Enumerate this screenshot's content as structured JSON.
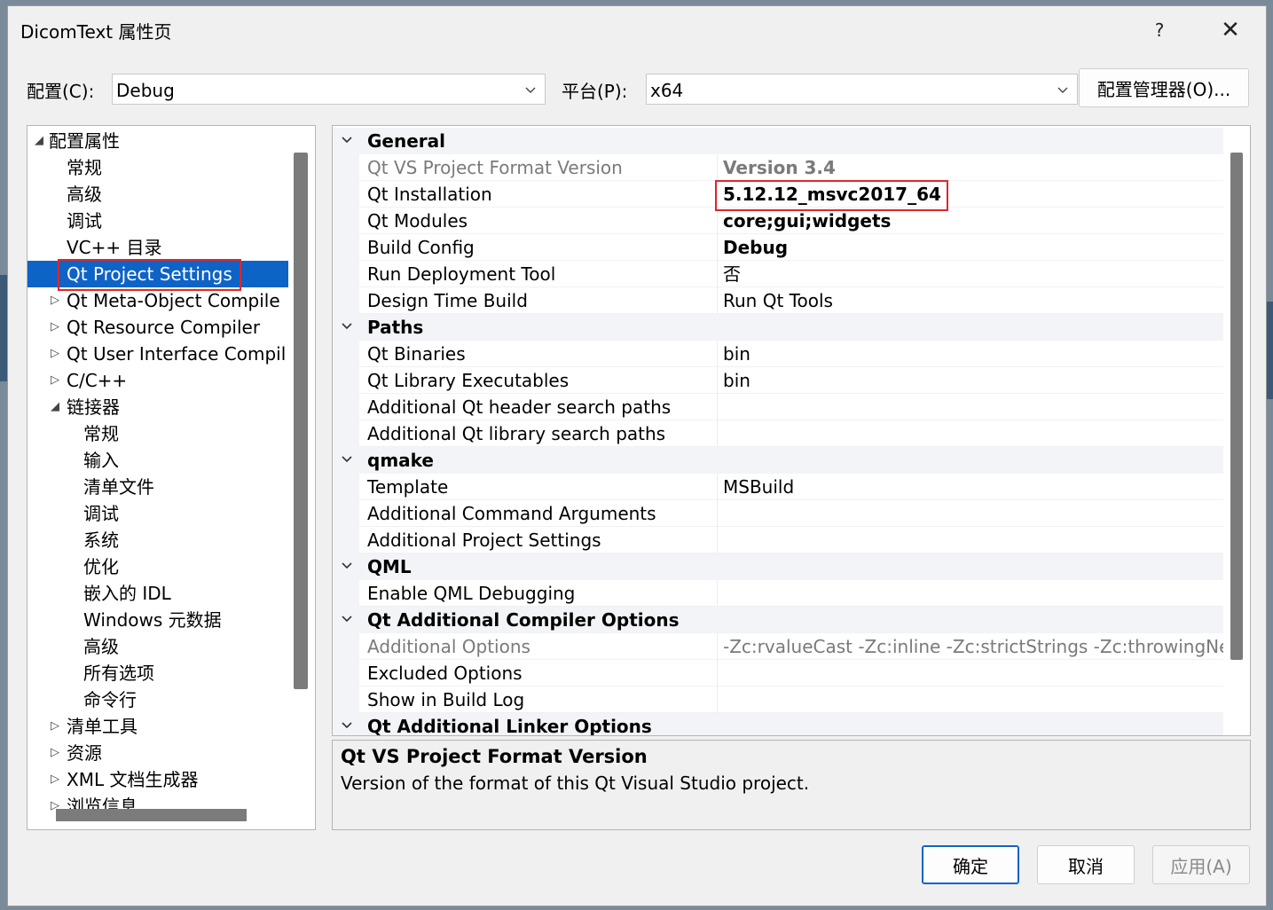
{
  "window": {
    "title": "DicomText 属性页",
    "help_label": "?",
    "close_label": "✕"
  },
  "config_bar": {
    "config_label": "配置(C):",
    "config_value": "Debug",
    "platform_label": "平台(P):",
    "platform_value": "x64",
    "manager_button": "配置管理器(O)..."
  },
  "tree": {
    "items": [
      {
        "label": "配置属性",
        "arrow": "◢"
      },
      {
        "label": "常规",
        "arrow": ""
      },
      {
        "label": "高级",
        "arrow": ""
      },
      {
        "label": "调试",
        "arrow": ""
      },
      {
        "label": "VC++ 目录",
        "arrow": ""
      },
      {
        "label": "Qt Project Settings",
        "arrow": ""
      },
      {
        "label": "Qt Meta-Object Compile",
        "arrow": "▷"
      },
      {
        "label": "Qt Resource Compiler",
        "arrow": "▷"
      },
      {
        "label": "Qt User Interface Compil",
        "arrow": "▷"
      },
      {
        "label": "C/C++",
        "arrow": "▷"
      },
      {
        "label": "链接器",
        "arrow": "◢"
      },
      {
        "label": "常规",
        "arrow": ""
      },
      {
        "label": "输入",
        "arrow": ""
      },
      {
        "label": "清单文件",
        "arrow": ""
      },
      {
        "label": "调试",
        "arrow": ""
      },
      {
        "label": "系统",
        "arrow": ""
      },
      {
        "label": "优化",
        "arrow": ""
      },
      {
        "label": "嵌入的 IDL",
        "arrow": ""
      },
      {
        "label": "Windows 元数据",
        "arrow": ""
      },
      {
        "label": "高级",
        "arrow": ""
      },
      {
        "label": "所有选项",
        "arrow": ""
      },
      {
        "label": "命令行",
        "arrow": ""
      },
      {
        "label": "清单工具",
        "arrow": "▷"
      },
      {
        "label": "资源",
        "arrow": "▷"
      },
      {
        "label": "XML 文档生成器",
        "arrow": "▷"
      },
      {
        "label": "浏览信息",
        "arrow": "▷"
      }
    ]
  },
  "grid": {
    "rows": [
      {
        "type": "cat",
        "name": "General"
      },
      {
        "type": "prop",
        "name": "Qt VS Project Format Version",
        "value": "Version 3.4"
      },
      {
        "type": "prop",
        "name": "Qt Installation",
        "value": "5.12.12_msvc2017_64"
      },
      {
        "type": "prop",
        "name": "Qt Modules",
        "value": "core;gui;widgets"
      },
      {
        "type": "prop",
        "name": "Build Config",
        "value": "Debug"
      },
      {
        "type": "prop",
        "name": "Run Deployment Tool",
        "value": "否"
      },
      {
        "type": "prop",
        "name": "Design Time Build",
        "value": "Run Qt Tools"
      },
      {
        "type": "cat",
        "name": "Paths"
      },
      {
        "type": "prop",
        "name": "Qt Binaries",
        "value": "bin"
      },
      {
        "type": "prop",
        "name": "Qt Library Executables",
        "value": "bin"
      },
      {
        "type": "prop",
        "name": "Additional Qt header search paths",
        "value": ""
      },
      {
        "type": "prop",
        "name": "Additional Qt library search paths",
        "value": ""
      },
      {
        "type": "cat",
        "name": "qmake"
      },
      {
        "type": "prop",
        "name": "Template",
        "value": "MSBuild"
      },
      {
        "type": "prop",
        "name": "Additional Command Arguments",
        "value": ""
      },
      {
        "type": "prop",
        "name": "Additional Project Settings",
        "value": ""
      },
      {
        "type": "cat",
        "name": "QML"
      },
      {
        "type": "prop",
        "name": "Enable QML Debugging",
        "value": ""
      },
      {
        "type": "cat",
        "name": "Qt Additional Compiler Options"
      },
      {
        "type": "prop",
        "name": "Additional Options",
        "value": "-Zc:rvalueCast -Zc:inline -Zc:strictStrings -Zc:throwingNew"
      },
      {
        "type": "prop",
        "name": "Excluded Options",
        "value": ""
      },
      {
        "type": "prop",
        "name": "Show in Build Log",
        "value": ""
      },
      {
        "type": "cat",
        "name": "Qt Additional Linker Options"
      }
    ]
  },
  "description": {
    "title": "Qt VS Project Format Version",
    "text": "Version of the format of this Qt Visual Studio project."
  },
  "buttons": {
    "ok": "确定",
    "cancel": "取消",
    "apply": "应用(A)"
  },
  "colors": {
    "selection": "#0e63c6",
    "highlight_box": "#e0262a"
  }
}
